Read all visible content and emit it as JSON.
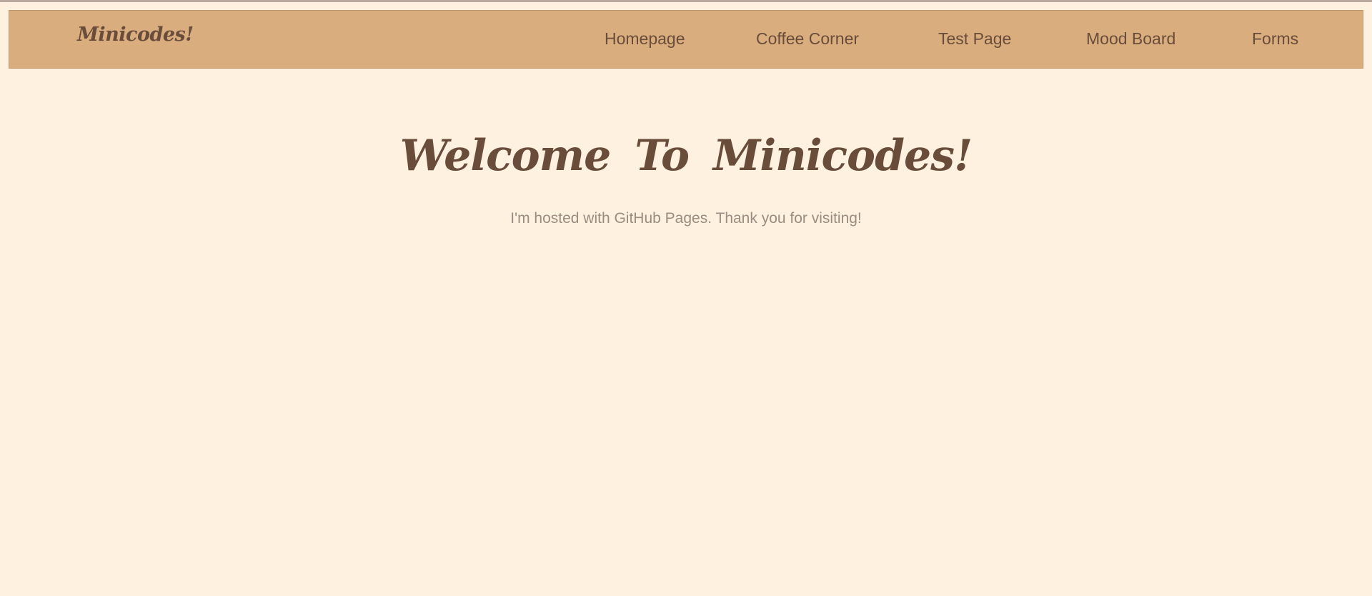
{
  "header": {
    "brand": "Minicodes!",
    "nav": [
      {
        "label": "Homepage"
      },
      {
        "label": "Coffee Corner"
      },
      {
        "label": "Test Page"
      },
      {
        "label": "Mood Board"
      },
      {
        "label": "Forms"
      }
    ]
  },
  "main": {
    "title": "Welcome To Minicodes!",
    "subtitle": "I'm hosted with GitHub Pages. Thank you for visiting!"
  },
  "colors": {
    "background": "#fef1df",
    "navbar": "#d9ad7d",
    "text_dark": "#6a4c3b",
    "text_muted": "#9b8c82"
  }
}
